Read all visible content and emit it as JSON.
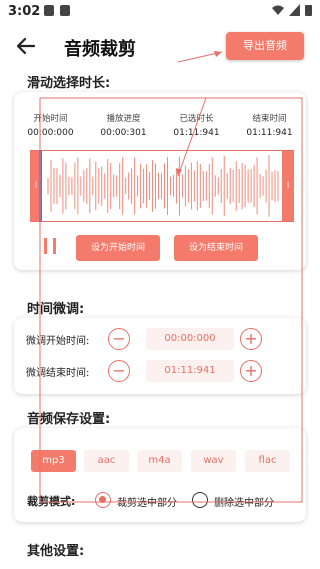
{
  "status": {
    "time": "3:02"
  },
  "header": {
    "title": "音频裁剪",
    "export_label": "导出音频"
  },
  "sections": {
    "duration": "滑动选择时长:",
    "fine_tune": "时间微调:",
    "save": "音频保存设置:",
    "other": "其他设置:"
  },
  "timeline": {
    "columns": [
      {
        "label": "开始时间",
        "value": "00:00:000"
      },
      {
        "label": "播放进度",
        "value": "00:00:301"
      },
      {
        "label": "已选时长",
        "value": "01:11:941"
      },
      {
        "label": "结束时间",
        "value": "01:11:941"
      }
    ],
    "set_start_label": "设为开始时间",
    "set_end_label": "设为结束时间"
  },
  "fine": {
    "start_label": "微调开始时间:",
    "start_value": "00:00:000",
    "end_label": "微调结束时间:",
    "end_value": "01:11:941"
  },
  "formats": {
    "options": [
      "mp3",
      "aac",
      "m4a",
      "wav",
      "flac"
    ],
    "selected": "mp3"
  },
  "trim_mode": {
    "label": "裁剪模式:",
    "options": [
      "裁剪选中部分",
      "删除选中部分"
    ],
    "selected": "裁剪选中部分"
  },
  "colors": {
    "accent": "#f47a6b",
    "cursor": "#4a7de8"
  }
}
